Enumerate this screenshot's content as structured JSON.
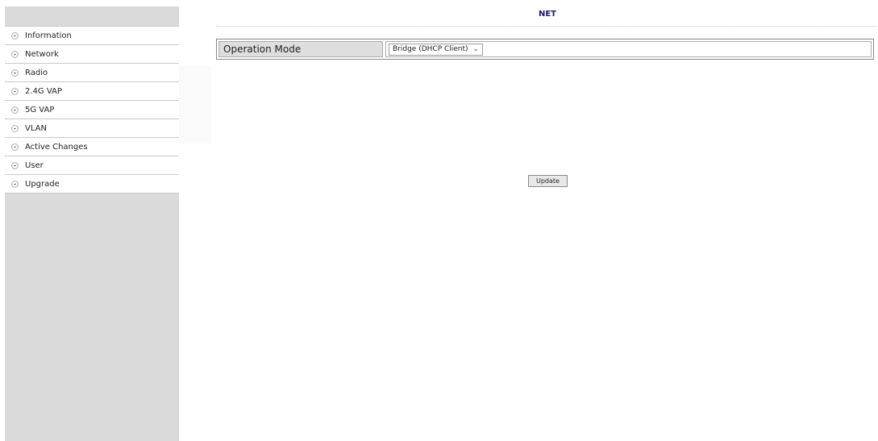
{
  "header": {
    "title": "NET"
  },
  "sidebar": {
    "items": [
      {
        "label": "Information"
      },
      {
        "label": "Network"
      },
      {
        "label": "Radio"
      },
      {
        "label": "2.4G VAP"
      },
      {
        "label": "5G VAP"
      },
      {
        "label": "VLAN"
      },
      {
        "label": "Active Changes"
      },
      {
        "label": "User"
      },
      {
        "label": "Upgrade"
      }
    ]
  },
  "form": {
    "operation_mode_label": "Operation Mode",
    "operation_mode_value": "Bridge (DHCP Client)"
  },
  "actions": {
    "update_label": "Update"
  },
  "icons": {
    "bullet": "minus-circle-icon",
    "select": "chevron-down-icon"
  }
}
